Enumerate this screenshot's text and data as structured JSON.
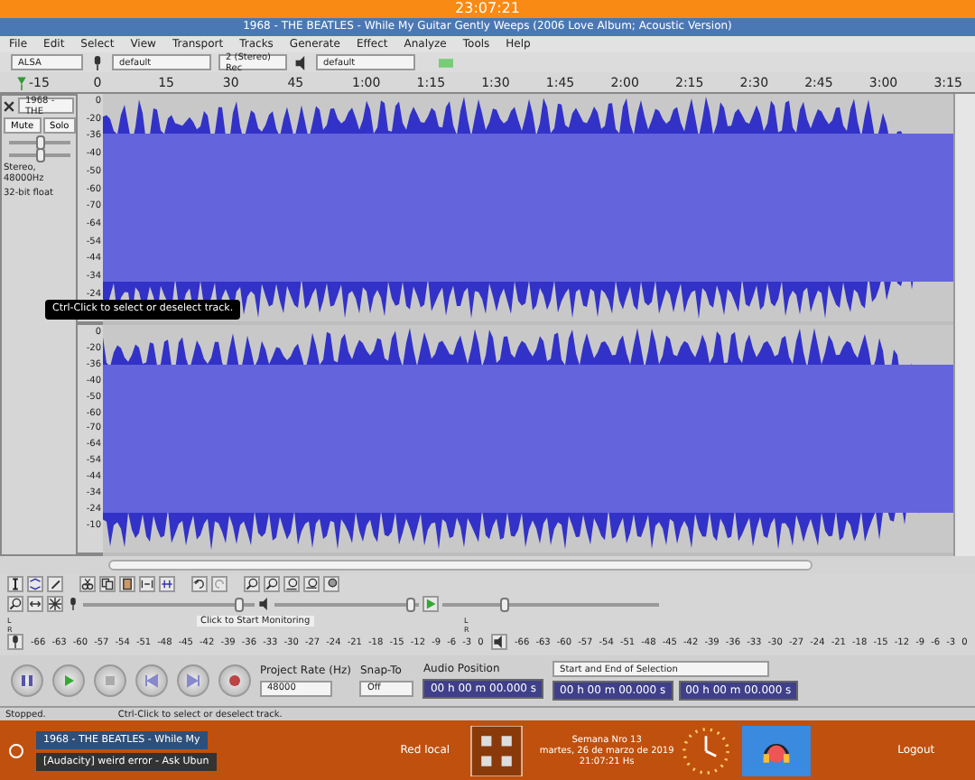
{
  "top_panel": {
    "clock": "23:07:21"
  },
  "window": {
    "title": "1968 - THE BEATLES - While My Guitar Gently Weeps (2006 Love Album; Acoustic Version)"
  },
  "menu": [
    "File",
    "Edit",
    "Select",
    "View",
    "Transport",
    "Tracks",
    "Generate",
    "Effect",
    "Analyze",
    "Tools",
    "Help"
  ],
  "device_toolbar": {
    "host": "ALSA",
    "recording_device": "default",
    "channels": "2 (Stereo) Rec",
    "playback_device": "default"
  },
  "ruler": {
    "ticks": [
      "-15",
      "0",
      "15",
      "30",
      "45",
      "1:00",
      "1:15",
      "1:30",
      "1:45",
      "2:00",
      "2:15",
      "2:30",
      "2:45",
      "3:00",
      "3:15"
    ]
  },
  "track": {
    "name": "1968 - THE",
    "mute": "Mute",
    "solo": "Solo",
    "gain": {
      "level": 0.5
    },
    "pan": {
      "level": 0.5
    },
    "info": [
      "Stereo, 48000Hz",
      "32-bit float"
    ],
    "channels": [
      {
        "scale": [
          "0",
          "-20",
          "-36",
          "-40",
          "-50",
          "-60",
          "-70",
          "-64",
          "-54",
          "-44",
          "-34",
          "-24"
        ]
      },
      {
        "scale": [
          "0",
          "-20",
          "-36",
          "-40",
          "-50",
          "-60",
          "-70",
          "-64",
          "-54",
          "-44",
          "-34",
          "-24",
          "-10"
        ]
      }
    ]
  },
  "tooltip": "Ctrl-Click to select or deselect track.",
  "meters": {
    "monitor_hint": "Click to Start Monitoring",
    "record_channel_labels": [
      "L",
      "R"
    ],
    "play_channel_labels": [
      "L",
      "R"
    ],
    "record_volume": {
      "level": 0.93
    },
    "playback_volume": {
      "level": 0.97
    },
    "play_speed": {
      "level": 0.28
    },
    "record_scale": [
      "-66",
      "-63",
      "-60",
      "-57",
      "-54",
      "-51",
      "-48",
      "-45",
      "-42",
      "-39",
      "-36",
      "-33",
      "-30",
      "-27",
      "-24",
      "-21",
      "-18",
      "-15",
      "-12",
      "-9",
      "-6",
      "-3",
      "0"
    ],
    "play_scale": [
      "-66",
      "-63",
      "-60",
      "-57",
      "-54",
      "-51",
      "-48",
      "-45",
      "-42",
      "-39",
      "-36",
      "-33",
      "-30",
      "-27",
      "-24",
      "-21",
      "-18",
      "-15",
      "-12",
      "-9",
      "-6",
      "-3",
      "0"
    ]
  },
  "selection_toolbar": {
    "project_rate_label": "Project Rate (Hz)",
    "project_rate": "48000",
    "snap_label": "Snap-To",
    "snap": "Off",
    "audio_position_label": "Audio Position",
    "audio_position": "00 h 00 m 00.000 s",
    "selection_mode": "Start and End of Selection",
    "selection_start": "00 h 00 m 00.000 s",
    "selection_end": "00 h 00 m 00.000 s"
  },
  "status_bar": [
    "Stopped.",
    "Ctrl-Click to select or deselect track."
  ],
  "taskbar": {
    "windows": [
      {
        "label": "1968 - THE BEATLES - While My",
        "selected": true
      },
      {
        "label": "[Audacity] weird error - Ask Ubun",
        "selected": false
      }
    ],
    "network": "Red local",
    "date_lines": [
      "Semana Nro 13",
      "martes, 26 de marzo de 2019",
      "21:07:21 Hs"
    ],
    "user": "Logout"
  }
}
